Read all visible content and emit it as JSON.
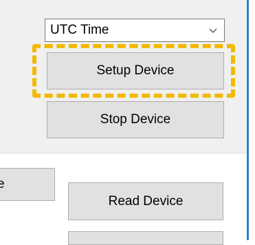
{
  "combo": {
    "selected": "UTC Time",
    "icon": "chevron-down-icon"
  },
  "buttons": {
    "setup_label": "Setup Device",
    "stop_label": "Stop Device",
    "partial_label": "e",
    "read_label": "Read Device"
  },
  "colors": {
    "highlight": "#f3b900",
    "window_border": "#2f7fd1",
    "button_face": "#e1e1e1",
    "panel_background": "#f0f0f0"
  }
}
